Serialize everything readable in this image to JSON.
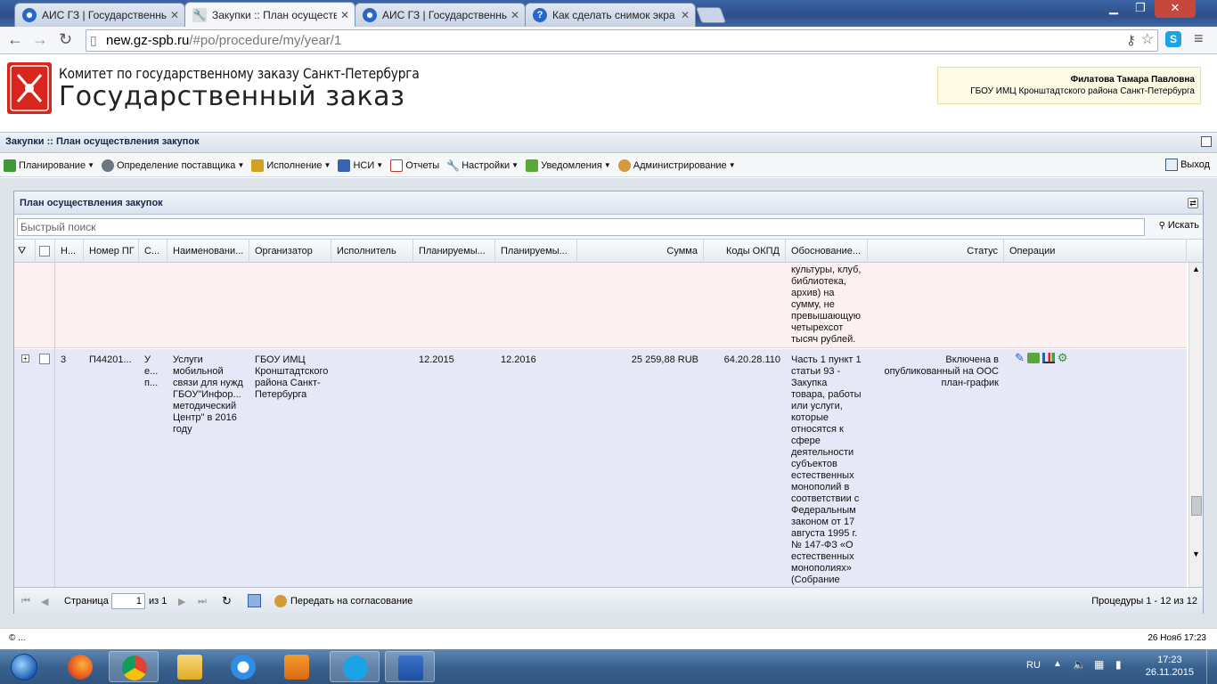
{
  "browser": {
    "tabs": [
      {
        "title": "АИС ГЗ | Государственны",
        "color": "#2a66c8"
      },
      {
        "title": "Закупки :: План осуществ",
        "color": "#6b6b6b"
      },
      {
        "title": "АИС ГЗ | Государственны",
        "color": "#2a66c8"
      },
      {
        "title": "Как сделать снимок экра",
        "color": "#2a66c8"
      }
    ],
    "url_host": "new.gz-spb.ru",
    "url_path": "/#po/procedure/my/year/1"
  },
  "site": {
    "org_name": "Комитет по государственному заказу Санкт-Петербурга",
    "title": "Государственный заказ",
    "user_name": "Филатова Тамара Павловна",
    "user_org": "ГБОУ ИМЦ Кронштадтского района Санкт-Петербурга"
  },
  "module_title": "Закупки :: План осуществления закупок",
  "menu": {
    "items": [
      {
        "label": "Планирование",
        "icon": "planning-icon",
        "color": "#3a9a3a"
      },
      {
        "label": "Определение поставщика",
        "icon": "gears-icon",
        "color": "#6d7682"
      },
      {
        "label": "Исполнение",
        "icon": "execution-icon",
        "color": "#d4a021"
      },
      {
        "label": "НСИ",
        "icon": "book-icon",
        "color": "#3a62b5"
      },
      {
        "label": "Отчеты",
        "icon": "report-icon",
        "color": "#c0392b"
      },
      {
        "label": "Настройки",
        "icon": "wrench-icon",
        "color": "#6b7582"
      },
      {
        "label": "Уведомления",
        "icon": "notification-icon",
        "color": "#58a83a"
      },
      {
        "label": "Администрирование",
        "icon": "user-icon",
        "color": "#d29a38"
      }
    ],
    "exit_label": "Выход"
  },
  "panel": {
    "title": "План осуществления закупок",
    "search_placeholder": "Быстрый поиск",
    "search_button": "Искать"
  },
  "grid": {
    "columns": [
      "Н...",
      "Номер ПГ",
      "С...",
      "Наименовани...",
      "Организатор",
      "Исполнитель",
      "Планируемы...",
      "Планируемы...",
      "Сумма",
      "Коды ОКПД",
      "Обоснование...",
      "Статус",
      "Операции"
    ],
    "rows": [
      {
        "num": "",
        "pg": "",
        "s": "",
        "name": "",
        "organizer": "",
        "executor": "",
        "plan1": "",
        "plan2": "",
        "sum": "",
        "okpd": "",
        "basis": "культуры, клуб, библиотека, архив) на сумму, не превышающую четырехсот тысяч рублей.",
        "status": ""
      },
      {
        "num": "3",
        "pg": "П44201...",
        "s": "У е... п...",
        "name": "Услуги мобильной связи для нужд ГБОУ\"Инфор... методический Центр\" в 2016 году",
        "organizer": "ГБОУ ИМЦ Кронштадтского района Санкт-Петербурга",
        "executor": "",
        "plan1": "12.2015",
        "plan2": "12.2016",
        "sum": "25 259,88 RUB",
        "okpd": "64.20.28.110",
        "basis": "Часть 1 пункт 1 статьи 93 - Закупка товара, работы или услуги, которые относятся к сфере деятельности субъектов естественных монополий в соответствии с Федеральным законом от 17 августа 1995 г. № 147-ФЗ «О естественных монополиях» (Собрание законодатель... Российской",
        "status": "Включена в опубликованный на ООС план-график"
      }
    ]
  },
  "pager": {
    "page_label": "Страница",
    "page_value": "1",
    "of_label": "из 1",
    "send_label": "Передать на согласование",
    "summary": "Процедуры 1 - 12 из 12"
  },
  "footer": {
    "copyright": "© ...",
    "datetime": "26 Нояб 17:23"
  },
  "taskbar": {
    "lang": "RU",
    "time": "17:23",
    "date": "26.11.2015"
  }
}
